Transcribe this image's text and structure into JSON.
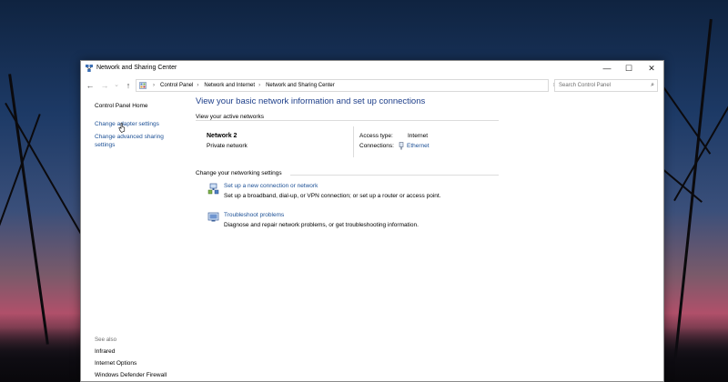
{
  "window": {
    "title": "Network and Sharing Center",
    "min_glyph": "—",
    "max_glyph": "☐",
    "close_glyph": "✕"
  },
  "address": {
    "back_glyph": "←",
    "forward_glyph": "→",
    "recent_glyph": "⌄",
    "up_glyph": "↑",
    "breadcrumbs": [
      "Control Panel",
      "Network and Internet",
      "Network and Sharing Center"
    ],
    "separator": "›",
    "dropdown_glyph": "⌄",
    "refresh_glyph": "↻",
    "search_placeholder": "Search Control Panel",
    "search_glyph": "⌕"
  },
  "sidebar": {
    "home": "Control Panel Home",
    "links": [
      "Change adapter settings",
      "Change advanced sharing settings"
    ],
    "see_also_label": "See also",
    "see_also": [
      "Infrared",
      "Internet Options",
      "Windows Defender Firewall"
    ]
  },
  "main": {
    "title": "View your basic network information and set up connections",
    "active_networks_label": "View your active networks",
    "network": {
      "name": "Network 2",
      "type": "Private network",
      "access_type_label": "Access type:",
      "access_type_value": "Internet",
      "connections_label": "Connections:",
      "connections_value": "Ethernet"
    },
    "change_settings_label": "Change your networking settings",
    "tasks": [
      {
        "link": "Set up a new connection or network",
        "desc": "Set up a broadband, dial-up, or VPN connection; or set up a router or access point.",
        "icon": "network-setup-icon"
      },
      {
        "link": "Troubleshoot problems",
        "desc": "Diagnose and repair network problems, or get troubleshooting information.",
        "icon": "troubleshoot-icon"
      }
    ]
  },
  "colors": {
    "link": "#1b4f95",
    "title_blue": "#1e3f8a"
  }
}
